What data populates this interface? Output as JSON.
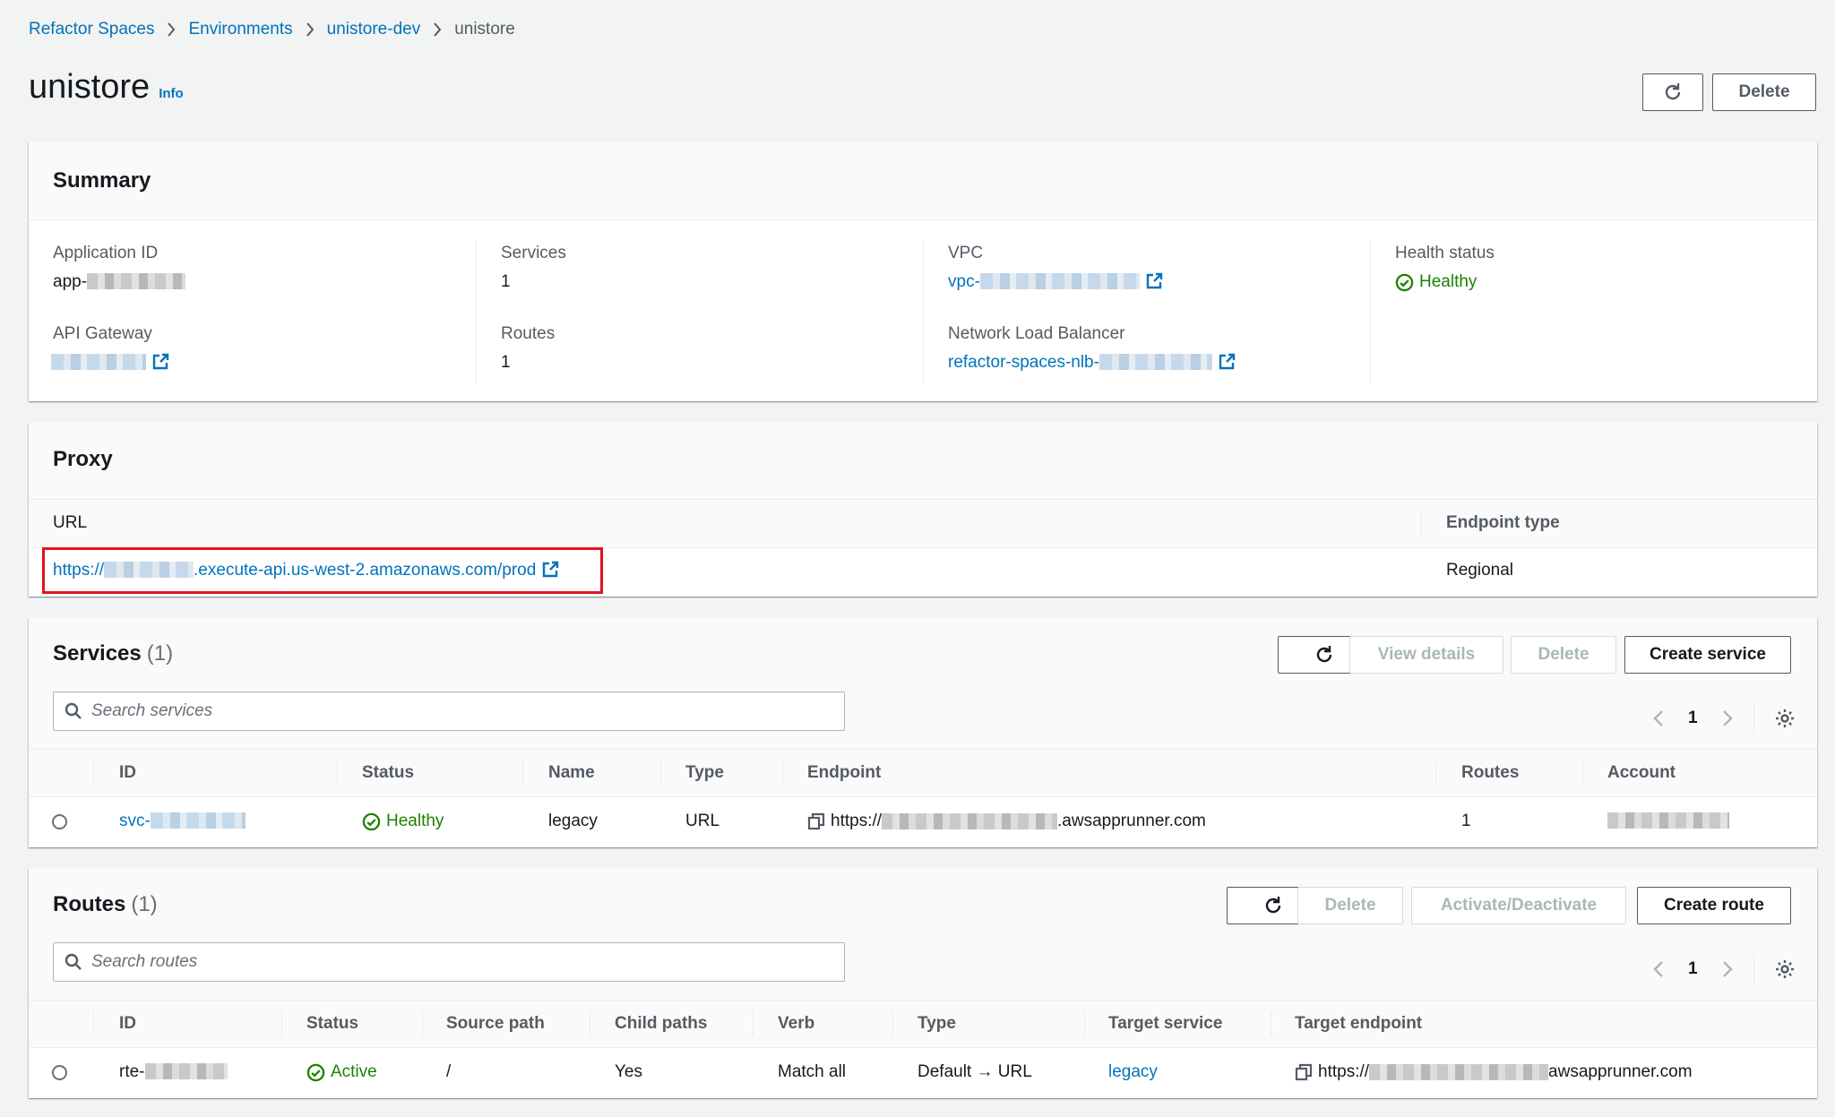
{
  "breadcrumb": {
    "items": [
      "Refactor Spaces",
      "Environments",
      "unistore-dev"
    ],
    "current": "unistore"
  },
  "page": {
    "title": "unistore",
    "info_label": "Info",
    "delete_label": "Delete"
  },
  "summary": {
    "title": "Summary",
    "application_id": {
      "label": "Application ID",
      "value_prefix": "app-"
    },
    "api_gateway": {
      "label": "API Gateway"
    },
    "services": {
      "label": "Services",
      "value": "1"
    },
    "routes": {
      "label": "Routes",
      "value": "1"
    },
    "vpc": {
      "label": "VPC",
      "value_prefix": "vpc-"
    },
    "nlb": {
      "label": "Network Load Balancer",
      "value_prefix": "refactor-spaces-nlb-"
    },
    "health": {
      "label": "Health status",
      "value": "Healthy"
    }
  },
  "proxy": {
    "title": "Proxy",
    "url_header": "URL",
    "endpoint_type_header": "Endpoint type",
    "url_prefix": "https://",
    "url_suffix": ".execute-api.us-west-2.amazonaws.com/prod",
    "endpoint_type": "Regional"
  },
  "services": {
    "title": "Services",
    "count": "(1)",
    "view_details_label": "View details",
    "delete_label": "Delete",
    "create_label": "Create service",
    "search_placeholder": "Search services",
    "page": "1",
    "columns": [
      "ID",
      "Status",
      "Name",
      "Type",
      "Endpoint",
      "Routes",
      "Account"
    ],
    "row": {
      "id_prefix": "svc-",
      "status": "Healthy",
      "name": "legacy",
      "type": "URL",
      "endpoint_prefix": "https://",
      "endpoint_suffix": ".awsapprunner.com",
      "routes": "1"
    }
  },
  "routes": {
    "title": "Routes",
    "count": "(1)",
    "delete_label": "Delete",
    "activate_label": "Activate/Deactivate",
    "create_label": "Create route",
    "search_placeholder": "Search routes",
    "page": "1",
    "columns": [
      "ID",
      "Status",
      "Source path",
      "Child paths",
      "Verb",
      "Type",
      "Target service",
      "Target endpoint"
    ],
    "row": {
      "id_prefix": "rte-",
      "status": "Active",
      "source_path": "/",
      "child_paths": "Yes",
      "verb": "Match all",
      "type": "Default → URL",
      "target_service": "legacy",
      "endpoint_prefix": "https://",
      "endpoint_suffix": "awsapprunner.com"
    }
  },
  "colors": {
    "link": "#0073bb",
    "success": "#1d8102",
    "highlight": "#e0141e"
  }
}
